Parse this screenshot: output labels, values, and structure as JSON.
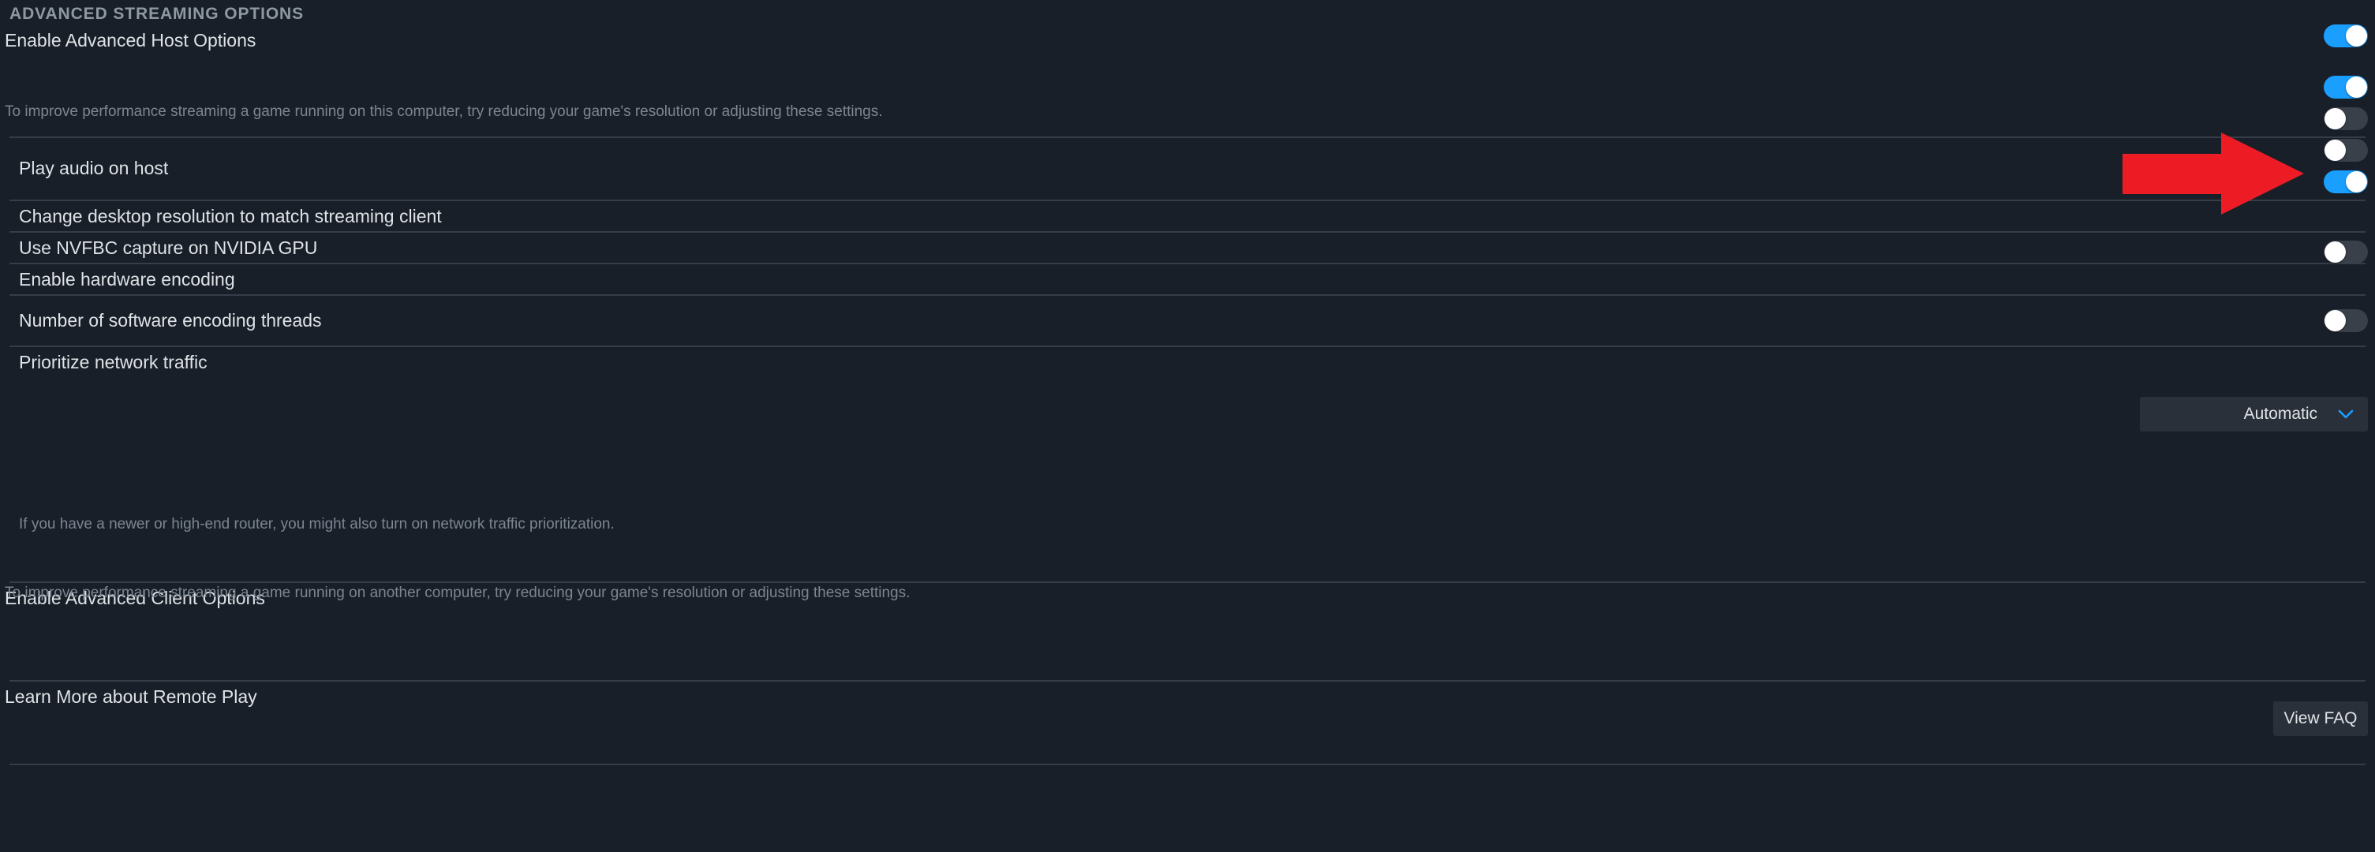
{
  "section": {
    "title": "ADVANCED STREAMING OPTIONS"
  },
  "host": {
    "title": "Enable Advanced Host Options",
    "description": "To improve performance streaming a game running on this computer, try reducing your game's resolution or adjusting these settings.",
    "toggle_state": "on"
  },
  "host_rows": [
    {
      "label": "Play audio on host",
      "toggle_state": "on"
    },
    {
      "label": "Change desktop resolution to match streaming client",
      "toggle_state": "off"
    },
    {
      "label": "Use NVFBC capture on NVIDIA GPU",
      "toggle_state": "off"
    },
    {
      "label": "Enable hardware encoding",
      "toggle_state": "on"
    }
  ],
  "encoding_threads": {
    "label": "Number of software encoding threads",
    "value": "Automatic",
    "chevron": "chevron-down-icon"
  },
  "network": {
    "label": "Prioritize network traffic",
    "description": "If you have a newer or high-end router, you might also turn on network traffic prioritization.",
    "toggle_state": "off"
  },
  "client": {
    "title": "Enable Advanced Client Options",
    "description": "To improve performance streaming a game running on another computer, try reducing your game's resolution or adjusting these settings.",
    "toggle_state": "off"
  },
  "learn_more": {
    "label": "Learn More about Remote Play",
    "button_label": "View FAQ"
  },
  "annotation": {
    "type": "arrow-right",
    "color": "#ED1C24",
    "points_to": "Play audio on host toggle"
  },
  "colors": {
    "background": "#181f29",
    "toggle_on": "#1a9fff",
    "toggle_off_track": "#3a4049",
    "separator": "#363d49",
    "control_bg": "#2a303a",
    "text_primary": "#dfe3e6",
    "text_secondary": "#7d8590",
    "header_text": "#8f98a0",
    "accent_chevron": "#1a9fff",
    "annotation_red": "#ED1C24"
  }
}
